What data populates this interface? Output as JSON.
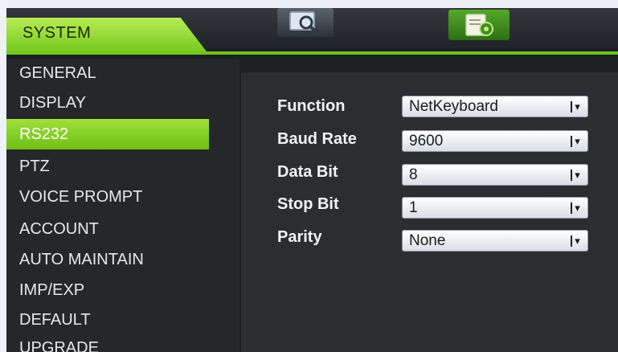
{
  "header": {
    "tab_label": "SYSTEM",
    "icons": [
      "search-icon",
      "settings-document-icon"
    ]
  },
  "sidebar": {
    "items": [
      {
        "label": "GENERAL",
        "active": false
      },
      {
        "label": "DISPLAY",
        "active": false
      },
      {
        "label": "RS232",
        "active": true
      },
      {
        "label": "PTZ",
        "active": false
      },
      {
        "label": "VOICE PROMPT",
        "active": false
      },
      {
        "label": "ACCOUNT",
        "active": false
      },
      {
        "label": "AUTO MAINTAIN",
        "active": false
      },
      {
        "label": "IMP/EXP",
        "active": false
      },
      {
        "label": "DEFAULT",
        "active": false
      },
      {
        "label": "UPGRADE",
        "active": false
      }
    ]
  },
  "form": {
    "fields": [
      {
        "label": "Function",
        "value": "NetKeyboard"
      },
      {
        "label": "Baud Rate",
        "value": "9600"
      },
      {
        "label": "Data Bit",
        "value": "8"
      },
      {
        "label": "Stop Bit",
        "value": "1"
      },
      {
        "label": "Parity",
        "value": "None"
      }
    ]
  },
  "colors": {
    "accent_green": "#7cc91f",
    "background_dark": "#1d1f22",
    "panel": "#2b2d31"
  }
}
